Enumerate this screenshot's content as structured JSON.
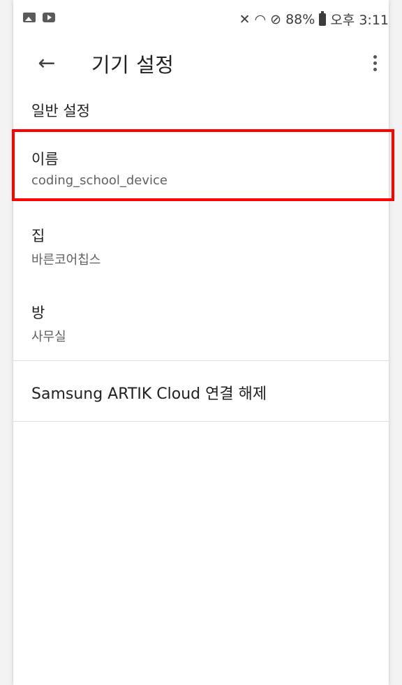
{
  "status_bar": {
    "battery": "88%",
    "time": "오후 3:11"
  },
  "app_bar": {
    "title": "기기 설정",
    "back_icon": "arrow-back-icon",
    "more_icon": "more-vert-icon"
  },
  "section": {
    "header": "일반 설정"
  },
  "preferences": [
    {
      "title": "이름",
      "summary": "coding_school_device"
    },
    {
      "title": "집",
      "summary": "바른코어칩스"
    },
    {
      "title": "방",
      "summary": "사무실"
    }
  ],
  "actions": {
    "disconnect": "Samsung ARTIK Cloud 연결 해제"
  },
  "colors": {
    "highlight": "#ff0000",
    "background": "#ffffff"
  }
}
